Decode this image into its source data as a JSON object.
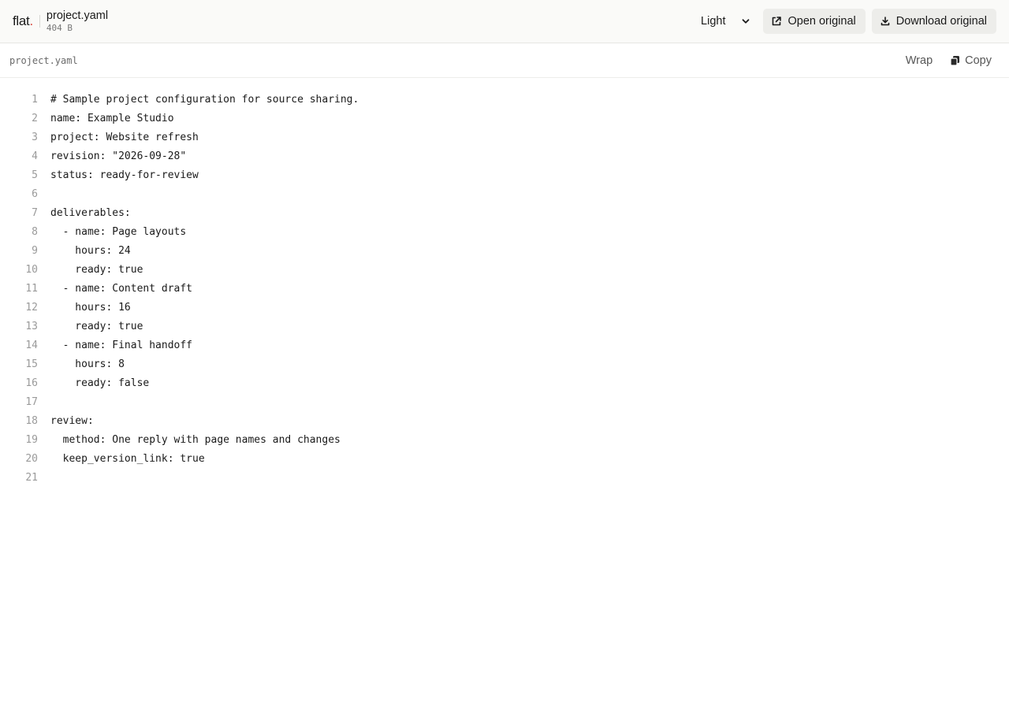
{
  "app": {
    "logo_text": "flat",
    "logo_dot": ".",
    "logo_dot_color": "#d9473b"
  },
  "file": {
    "name": "project.yaml",
    "size": "404 B"
  },
  "toolbar": {
    "theme_value": "Light",
    "open_label": "Open original",
    "download_label": "Download original"
  },
  "subbar": {
    "path": "project.yaml",
    "wrap_label": "Wrap",
    "copy_label": "Copy"
  },
  "icons": {
    "chevron": "chevron-down-icon",
    "open": "external-link-icon",
    "download": "download-icon",
    "copy": "copy-icon"
  },
  "code": {
    "lines": [
      {
        "n": "1",
        "t": "# Sample project configuration for source sharing."
      },
      {
        "n": "2",
        "t": "name: Example Studio"
      },
      {
        "n": "3",
        "t": "project: Website refresh"
      },
      {
        "n": "4",
        "t": "revision: \"2026-09-28\""
      },
      {
        "n": "5",
        "t": "status: ready-for-review"
      },
      {
        "n": "6",
        "t": ""
      },
      {
        "n": "7",
        "t": "deliverables:"
      },
      {
        "n": "8",
        "t": "  - name: Page layouts"
      },
      {
        "n": "9",
        "t": "    hours: 24"
      },
      {
        "n": "10",
        "t": "    ready: true"
      },
      {
        "n": "11",
        "t": "  - name: Content draft"
      },
      {
        "n": "12",
        "t": "    hours: 16"
      },
      {
        "n": "13",
        "t": "    ready: true"
      },
      {
        "n": "14",
        "t": "  - name: Final handoff"
      },
      {
        "n": "15",
        "t": "    hours: 8"
      },
      {
        "n": "16",
        "t": "    ready: false"
      },
      {
        "n": "17",
        "t": ""
      },
      {
        "n": "18",
        "t": "review:"
      },
      {
        "n": "19",
        "t": "  method: One reply with page names and changes"
      },
      {
        "n": "20",
        "t": "  keep_version_link: true"
      },
      {
        "n": "21",
        "t": ""
      }
    ]
  }
}
